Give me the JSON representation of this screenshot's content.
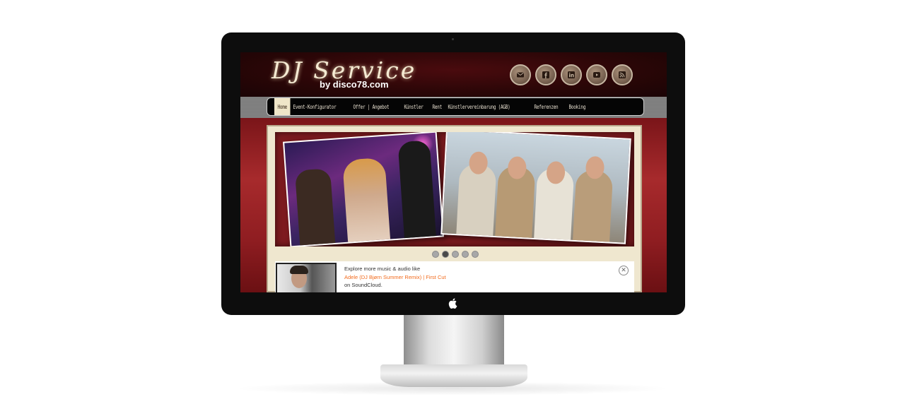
{
  "site": {
    "logo_script": "DJ Service",
    "logo_sub": "by disco78.com"
  },
  "social_icons": [
    {
      "name": "email-icon"
    },
    {
      "name": "facebook-icon"
    },
    {
      "name": "linkedin-icon"
    },
    {
      "name": "youtube-icon"
    },
    {
      "name": "rss-icon"
    }
  ],
  "nav": {
    "items": [
      {
        "label": "Home",
        "active": true
      },
      {
        "label": "Event-Konfigurator"
      },
      {
        "label": "Offer | Angebot"
      },
      {
        "label": "Künstler"
      },
      {
        "label": "Rent"
      },
      {
        "label": "Künstlervereinbarung (AGB)"
      },
      {
        "label": "Referenzen"
      },
      {
        "label": "Booking"
      }
    ]
  },
  "slider": {
    "active_index": 1,
    "dot_count": 5
  },
  "soundcloud": {
    "line1": "Explore more music & audio like",
    "link": "Adele (DJ Bjørn Summer Remix) | First Cut",
    "line3": "on SoundCloud."
  },
  "colors": {
    "header_bg": "#2a0607",
    "content_red": "#a72a2c",
    "panel_cream": "#efe7cf",
    "link_orange": "#f26b1d"
  }
}
